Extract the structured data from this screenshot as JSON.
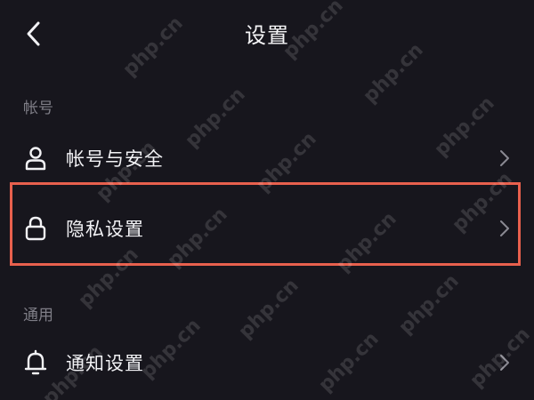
{
  "header": {
    "title": "设置",
    "back_icon": "chevron-left-icon"
  },
  "sections": [
    {
      "label": "帐号",
      "items": [
        {
          "label": "帐号与安全",
          "icon": "user-icon"
        },
        {
          "label": "隐私设置",
          "icon": "lock-icon",
          "highlighted": true
        }
      ]
    },
    {
      "label": "通用",
      "items": [
        {
          "label": "通知设置",
          "icon": "bell-icon"
        }
      ]
    }
  ],
  "watermark": "php.cn",
  "colors": {
    "background": "#17161d",
    "text": "#f2f2f5",
    "section_label": "#7f7e87",
    "highlight_border": "#e8604d",
    "chevron": "#8a8992"
  }
}
